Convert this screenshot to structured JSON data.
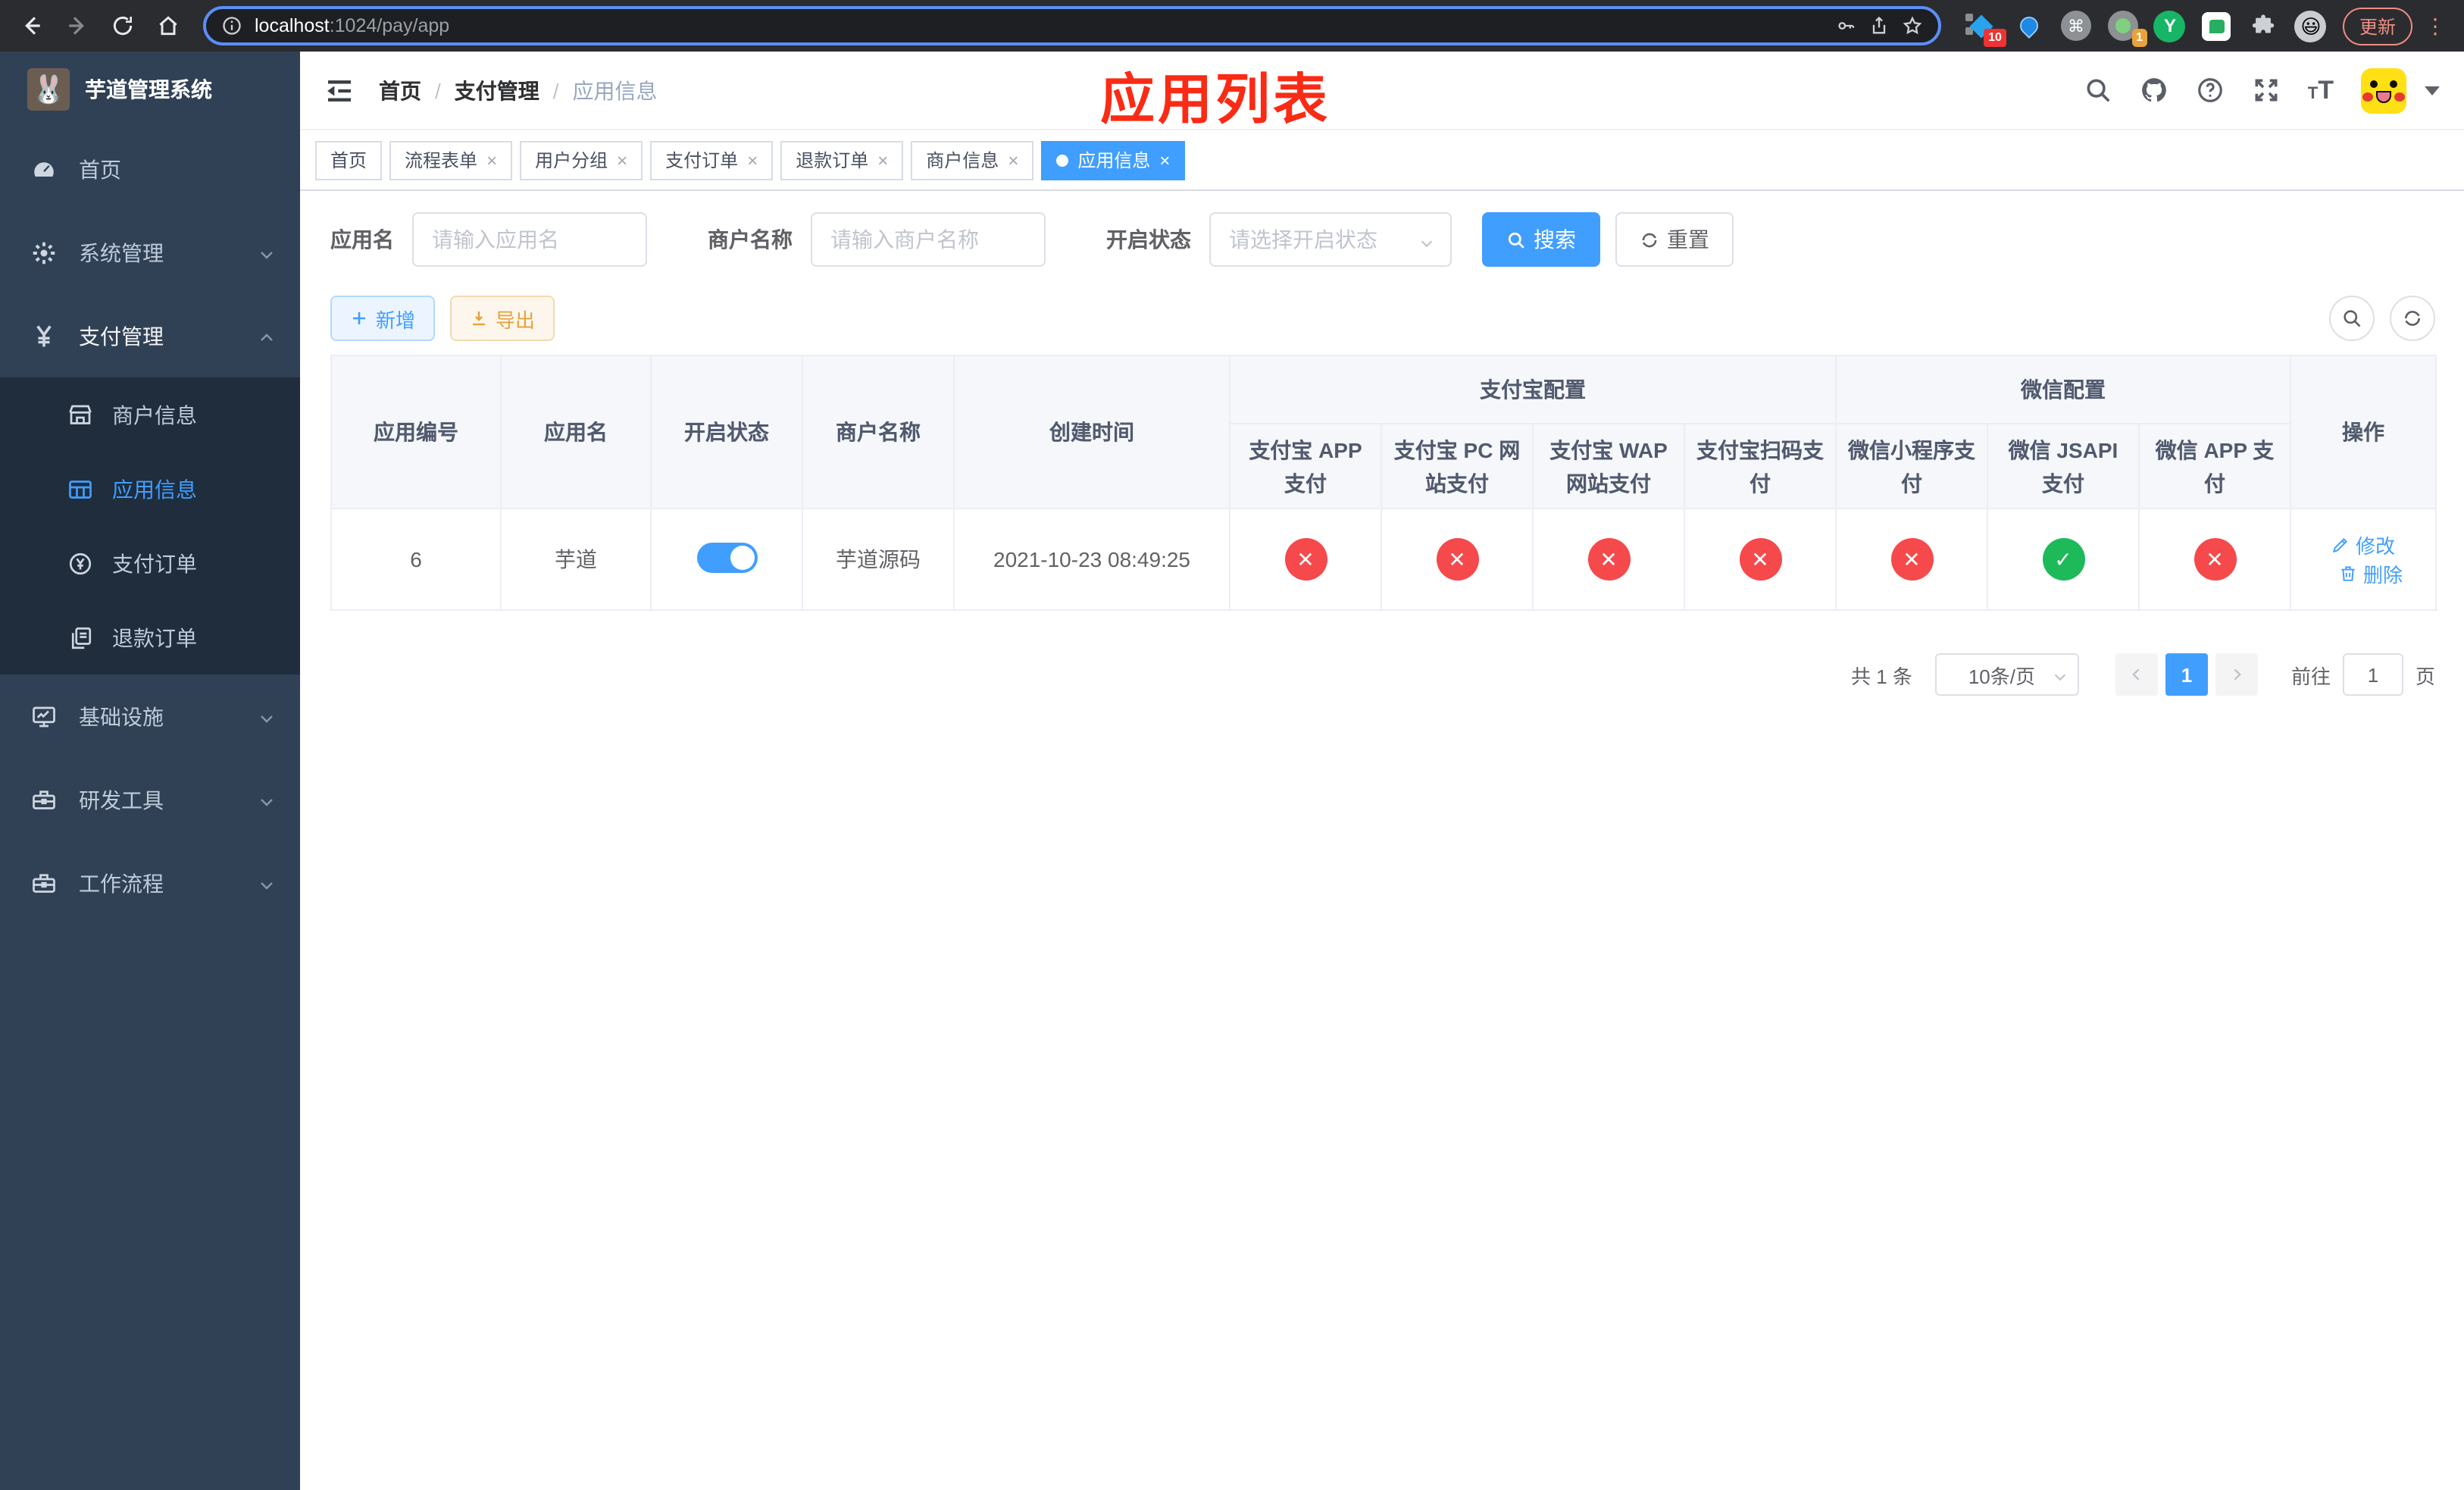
{
  "browser": {
    "url": {
      "host": "localhost",
      "rest": ":1024/pay/app"
    },
    "update_label": "更新",
    "extensions": {
      "badge1": "10",
      "badge2": "1",
      "y_label": "Y",
      "face": "😃"
    }
  },
  "sidebar": {
    "title": "芋道管理系统",
    "logo_glyph": "🐰",
    "menu": [
      {
        "label": "首页",
        "icon": "dashboard-icon",
        "type": "item"
      },
      {
        "label": "系统管理",
        "icon": "gear-icon",
        "type": "group",
        "state": "collapsed"
      },
      {
        "label": "支付管理",
        "icon": "yen-icon",
        "type": "group",
        "state": "expanded",
        "children": [
          {
            "label": "商户信息",
            "icon": "shop-icon",
            "active": false
          },
          {
            "label": "应用信息",
            "icon": "grid-icon",
            "active": true
          },
          {
            "label": "支付订单",
            "icon": "yen-circle-icon",
            "active": false
          },
          {
            "label": "退款订单",
            "icon": "document-icon",
            "active": false
          }
        ]
      },
      {
        "label": "基础设施",
        "icon": "monitor-icon",
        "type": "group",
        "state": "collapsed"
      },
      {
        "label": "研发工具",
        "icon": "toolbox-icon",
        "type": "group",
        "state": "collapsed"
      },
      {
        "label": "工作流程",
        "icon": "toolbox-icon",
        "type": "group",
        "state": "collapsed"
      }
    ]
  },
  "navbar": {
    "breadcrumb": [
      "首页",
      "支付管理",
      "应用信息"
    ],
    "annotation": "应用列表"
  },
  "tabs": [
    {
      "label": "首页",
      "closable": false,
      "active": false
    },
    {
      "label": "流程表单",
      "closable": true,
      "active": false
    },
    {
      "label": "用户分组",
      "closable": true,
      "active": false
    },
    {
      "label": "支付订单",
      "closable": true,
      "active": false
    },
    {
      "label": "退款订单",
      "closable": true,
      "active": false
    },
    {
      "label": "商户信息",
      "closable": true,
      "active": false
    },
    {
      "label": "应用信息",
      "closable": true,
      "active": true
    }
  ],
  "filters": {
    "app_name": {
      "label": "应用名",
      "placeholder": "请输入应用名",
      "value": ""
    },
    "merchant": {
      "label": "商户名称",
      "placeholder": "请输入商户名称",
      "value": ""
    },
    "status": {
      "label": "开启状态",
      "placeholder": "请选择开启状态"
    },
    "search_label": "搜索",
    "reset_label": "重置"
  },
  "toolbar": {
    "add_label": "新增",
    "export_label": "导出"
  },
  "table": {
    "columns": [
      "应用编号",
      "应用名",
      "开启状态",
      "商户名称",
      "创建时间"
    ],
    "groups": [
      {
        "label": "支付宝配置",
        "children": [
          "支付宝 APP 支付",
          "支付宝 PC 网站支付",
          "支付宝 WAP 网站支付",
          "支付宝扫码支付"
        ]
      },
      {
        "label": "微信配置",
        "children": [
          "微信小程序支付",
          "微信 JSAPI 支付",
          "微信 APP 支付"
        ]
      }
    ],
    "action_column": "操作",
    "rows": [
      {
        "id": "6",
        "name": "芋道",
        "enabled": true,
        "merchant": "芋道源码",
        "created": "2021-10-23 08:49:25",
        "pay_status": [
          "closed",
          "closed",
          "closed",
          "closed",
          "closed",
          "open",
          "closed"
        ],
        "edit_label": "修改",
        "delete_label": "删除"
      }
    ]
  },
  "pagination": {
    "total": "共 1 条",
    "page_size": "10条/页",
    "pages": [
      "1"
    ],
    "current": "1",
    "goto_label": "前往",
    "goto_value": "1",
    "unit_label": "页"
  },
  "colors": {
    "primary": "#409eff",
    "success": "#1eba5a",
    "danger": "#f5494c",
    "warning": "#e6a23c",
    "sidebar_bg": "#304156",
    "submenu_bg": "#1f2d3d",
    "annotation": "#fa2b15"
  }
}
